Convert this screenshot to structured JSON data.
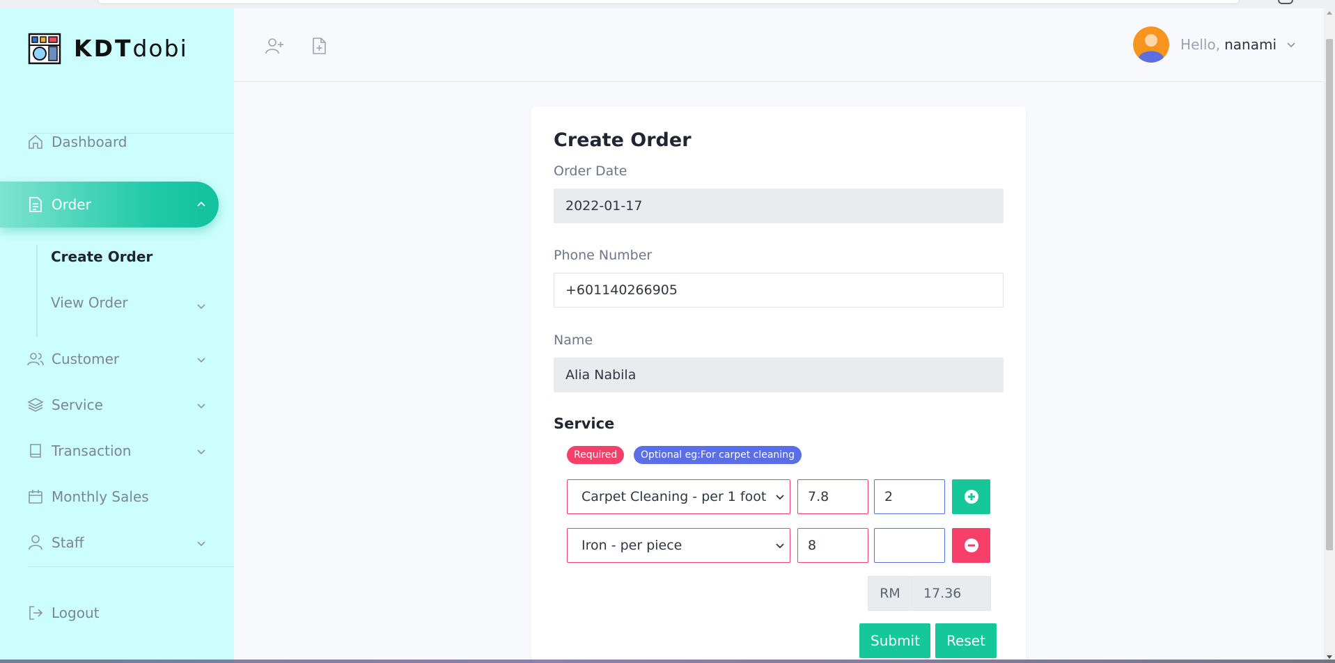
{
  "brand": {
    "bold": "KDT",
    "light": "dobi"
  },
  "sidebar": {
    "dashboard": "Dashboard",
    "order": "Order",
    "order_sub": [
      {
        "label": "Create Order"
      },
      {
        "label": "View Order"
      }
    ],
    "customer": "Customer",
    "service": "Service",
    "transaction": "Transaction",
    "monthly_sales": "Monthly Sales",
    "staff": "Staff",
    "logout": "Logout"
  },
  "header": {
    "hello": "Hello,",
    "username": "nanami"
  },
  "form": {
    "title": "Create Order",
    "order_date_label": "Order Date",
    "order_date_value": "2022-01-17",
    "phone_label": "Phone Number",
    "phone_value": "+601140266905",
    "name_label": "Name",
    "name_value": "Alia Nabila",
    "service_title": "Service",
    "badge_required": "Required",
    "badge_optional": "Optional eg:For carpet cleaning",
    "services": [
      {
        "service": "Carpet Cleaning - per 1 foot",
        "price": "7.8",
        "qty": "2"
      },
      {
        "service": "Iron - per piece",
        "price": "8",
        "qty": ""
      }
    ],
    "currency": "RM",
    "total": "17.36",
    "submit": "Submit",
    "reset": "Reset"
  },
  "colors": {
    "sidebar_bg": "#ccfefd",
    "accent": "#16c79a",
    "danger": "#f6406a",
    "info": "#5a6ee8"
  }
}
